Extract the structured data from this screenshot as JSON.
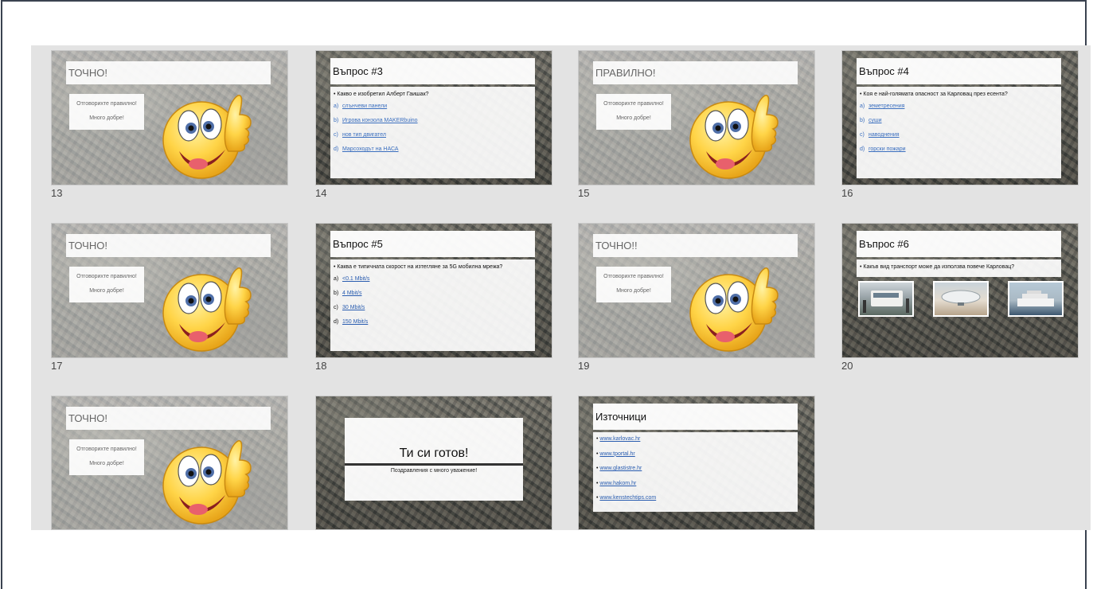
{
  "correct_box": {
    "line1": "Отговорихте правилно!",
    "line2": "Много добре!"
  },
  "slides": [
    {
      "num": "13",
      "title": "ТОЧНО!"
    },
    {
      "num": "14",
      "title": "Въпрос #3",
      "question": "• Какво е изобретил Алберт Гаишак?",
      "options": [
        {
          "letter": "a)",
          "text": "слънчеви панели"
        },
        {
          "letter": "b)",
          "text": "Игрова конзола MAKERbuino"
        },
        {
          "letter": "c)",
          "text": "нов тип двигател"
        },
        {
          "letter": "d)",
          "text": "Марсоходът на НАСА"
        }
      ]
    },
    {
      "num": "15",
      "title": "ПРАВИЛНО!"
    },
    {
      "num": "16",
      "title": "Въпрос #4",
      "question": "• Коя е най-голямата опасност за Карловац през есента?",
      "options": [
        {
          "letter": "a)",
          "text": "земетресения"
        },
        {
          "letter": "b)",
          "text": "суши"
        },
        {
          "letter": "c)",
          "text": "наводнения"
        },
        {
          "letter": "d)",
          "text": "горски пожари"
        }
      ]
    },
    {
      "num": "17",
      "title": "ТОЧНО!"
    },
    {
      "num": "18",
      "title": "Въпрос #5",
      "question": "• Каква е типичната скорост на изтегляне за 5G мобилна мрежа?",
      "options": [
        {
          "letter": "a)",
          "text": "<0.1 Mbit/s"
        },
        {
          "letter": "b)",
          "text": "4 Mbit/s"
        },
        {
          "letter": "c)",
          "text": "30 Mbit/s"
        },
        {
          "letter": "d)",
          "text": "150 Mbit/s"
        }
      ]
    },
    {
      "num": "19",
      "title": "ТОЧНО!!"
    },
    {
      "num": "20",
      "title": "Въпрос #6",
      "question": "• Какъв вид транспорт може да използва повече Карловац?"
    },
    {
      "num": "",
      "title": "ТОЧНО!"
    },
    {
      "num": "",
      "title": "Ти си готов!",
      "subtitle": "Поздравления с много уважение!"
    },
    {
      "num": "",
      "title": "Източници",
      "sources": [
        "www.karlovac.hr",
        "www.tportal.hr",
        "www.glastistre.hr",
        "www.hakom.hr",
        "www.kenstechtips.com"
      ]
    }
  ]
}
